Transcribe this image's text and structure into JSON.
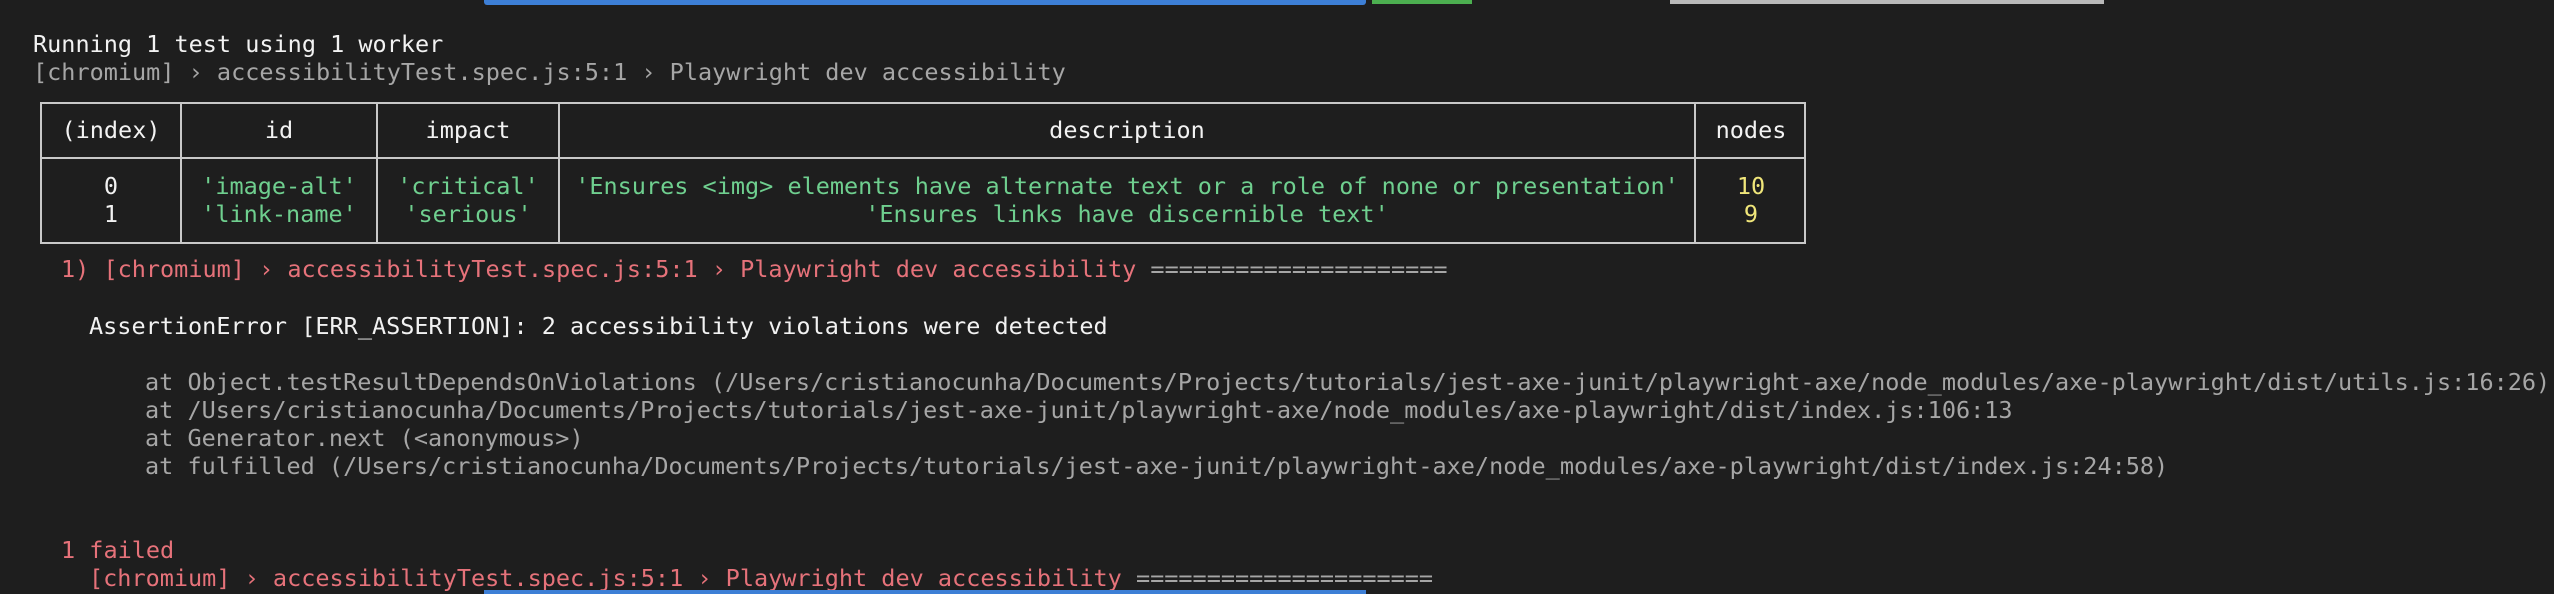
{
  "terminal": {
    "run_header": "Running 1 test using 1 worker",
    "test_line": "[chromium] › accessibilityTest.spec.js:5:1 › Playwright dev accessibility",
    "table": {
      "headers": [
        "(index)",
        "id",
        "impact",
        "description",
        "nodes"
      ],
      "rows": [
        {
          "index": "0",
          "id": "'image-alt'",
          "impact": "'critical'",
          "description": "'Ensures <img> elements have alternate text or a role of none or presentation'",
          "nodes": "10"
        },
        {
          "index": "1",
          "id": "'link-name'",
          "impact": "'serious'",
          "description": "'Ensures links have discernible text'",
          "nodes": "9"
        }
      ]
    },
    "failure_title": "1) [chromium] › accessibilityTest.spec.js:5:1 › Playwright dev accessibility ",
    "failure_rule": "=====================",
    "error_message": "AssertionError [ERR_ASSERTION]: 2 accessibility violations were detected",
    "stack": [
      "at Object.testResultDependsOnViolations (/Users/cristianocunha/Documents/Projects/tutorials/jest-axe-junit/playwright-axe/node_modules/axe-playwright/dist/utils.js:16:26)",
      "at /Users/cristianocunha/Documents/Projects/tutorials/jest-axe-junit/playwright-axe/node_modules/axe-playwright/dist/index.js:106:13",
      "at Generator.next (<anonymous>)",
      "at fulfilled (/Users/cristianocunha/Documents/Projects/tutorials/jest-axe-junit/playwright-axe/node_modules/axe-playwright/dist/index.js:24:58)"
    ],
    "summary_failed": "1 failed",
    "summary_test": "[chromium] › accessibilityTest.spec.js:5:1 › Playwright dev accessibility ",
    "summary_rule": "====================="
  },
  "colors": {
    "background": "#1e1e1e",
    "text": "#f2f2f2",
    "muted": "#a6a6a6",
    "error": "#e6727a",
    "string": "#6fcf8f",
    "number": "#f0e67a",
    "accent_blue": "#3d7fd6"
  }
}
